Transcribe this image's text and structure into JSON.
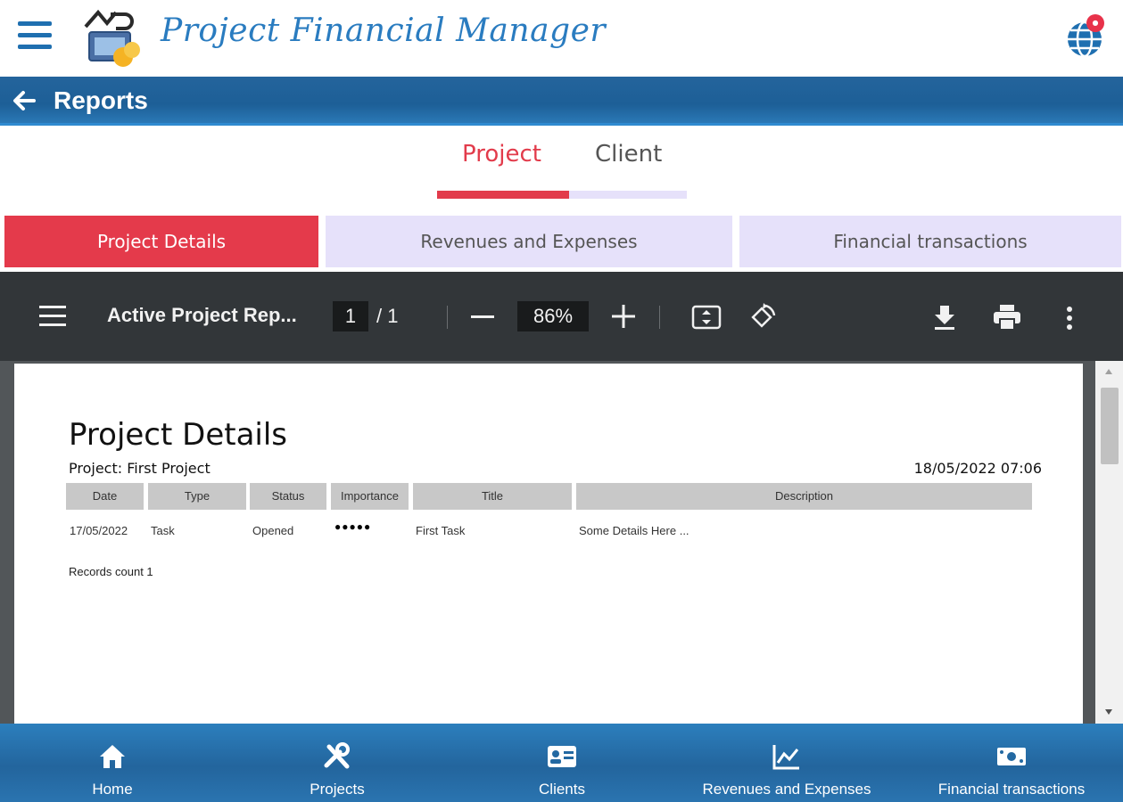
{
  "app": {
    "title": "Project Financial Manager",
    "language_badge": "●"
  },
  "reports_bar": {
    "title": "Reports"
  },
  "top_tabs": [
    {
      "label": "Project",
      "active": true
    },
    {
      "label": "Client",
      "active": false
    }
  ],
  "sub_tabs": [
    {
      "label": "Project Details",
      "active": true
    },
    {
      "label": "Revenues and Expenses",
      "active": false
    },
    {
      "label": "Financial transactions",
      "active": false
    }
  ],
  "pdf_viewer": {
    "title": "Active Project Rep...",
    "page": "1",
    "page_total": "/  1",
    "zoom": "86%"
  },
  "document": {
    "title": "Project Details",
    "project_line": "Project: First Project",
    "generated": "18/05/2022  07:06",
    "columns": [
      "Date",
      "Type",
      "Status",
      "Importance",
      "Title",
      "Description"
    ],
    "rows": [
      {
        "date": "17/05/2022",
        "type": "Task",
        "status": "Opened",
        "importance": "●●●●●",
        "title": "First Task",
        "description": "Some Details Here ..."
      }
    ],
    "records_count": "Records count 1"
  },
  "bottom_nav": [
    {
      "label": "Home",
      "icon": "home-icon"
    },
    {
      "label": "Projects",
      "icon": "tools-icon"
    },
    {
      "label": "Clients",
      "icon": "id-card-icon"
    },
    {
      "label": "Revenues and Expenses",
      "icon": "chart-icon"
    },
    {
      "label": "Financial transactions",
      "icon": "money-icon"
    }
  ],
  "colors": {
    "accent_red": "#e43a4b",
    "brand_blue": "#1f6fb0",
    "tab_inactive_bg": "#e6e1fa"
  }
}
